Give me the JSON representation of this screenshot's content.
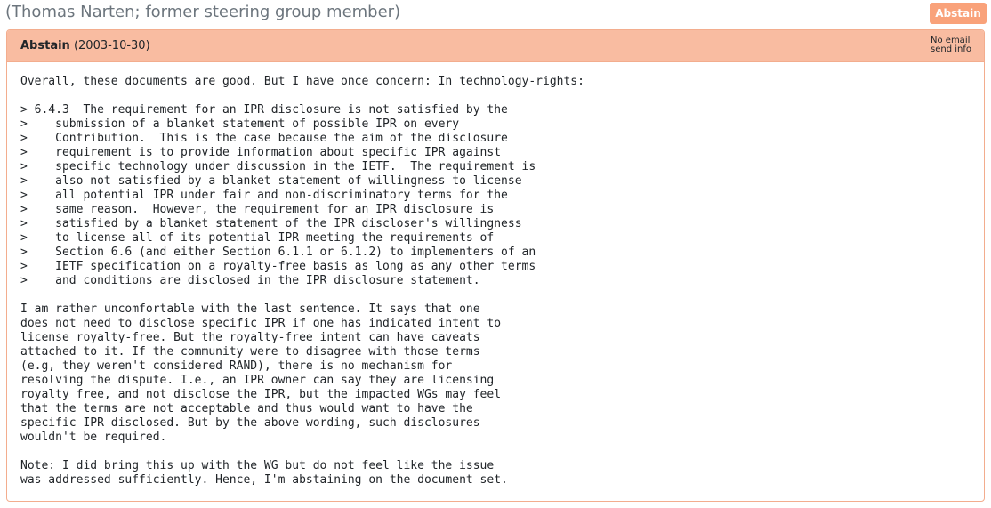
{
  "reviewer": {
    "name_line": "(Thomas Narten; former steering group member)"
  },
  "position_badge": {
    "label": "Abstain",
    "color": "#f9a27a"
  },
  "ballot": {
    "position": "Abstain",
    "date": "(2003-10-30)",
    "email_info_line1": "No email",
    "email_info_line2": "send info",
    "comment_text": "Overall, these documents are good. But I have once concern: In technology-rights:\n\n> 6.4.3  The requirement for an IPR disclosure is not satisfied by the\n>    submission of a blanket statement of possible IPR on every\n>    Contribution.  This is the case because the aim of the disclosure\n>    requirement is to provide information about specific IPR against\n>    specific technology under discussion in the IETF.  The requirement is\n>    also not satisfied by a blanket statement of willingness to license\n>    all potential IPR under fair and non-discriminatory terms for the\n>    same reason.  However, the requirement for an IPR disclosure is\n>    satisfied by a blanket statement of the IPR discloser's willingness\n>    to license all of its potential IPR meeting the requirements of\n>    Section 6.6 (and either Section 6.1.1 or 6.1.2) to implementers of an\n>    IETF specification on a royalty-free basis as long as any other terms\n>    and conditions are disclosed in the IPR disclosure statement.\n\nI am rather uncomfortable with the last sentence. It says that one\ndoes not need to disclose specific IPR if one has indicated intent to\nlicense royalty-free. But the royalty-free intent can have caveats\nattached to it. If the community were to disagree with those terms\n(e.g, they weren't considered RAND), there is no mechanism for\nresolving the dispute. I.e., an IPR owner can say they are licensing\nroyalty free, and not disclose the IPR, but the impacted WGs may feel\nthat the terms are not acceptable and thus would want to have the\nspecific IPR disclosed. But by the above wording, such disclosures\nwouldn't be required.\n\nNote: I did bring this up with the WG but do not feel like the issue\nwas addressed sufficiently. Hence, I'm abstaining on the document set."
  },
  "colors": {
    "header_bg": "#f9bca1",
    "border": "#f3ad8e",
    "muted_text": "#6c757d"
  }
}
